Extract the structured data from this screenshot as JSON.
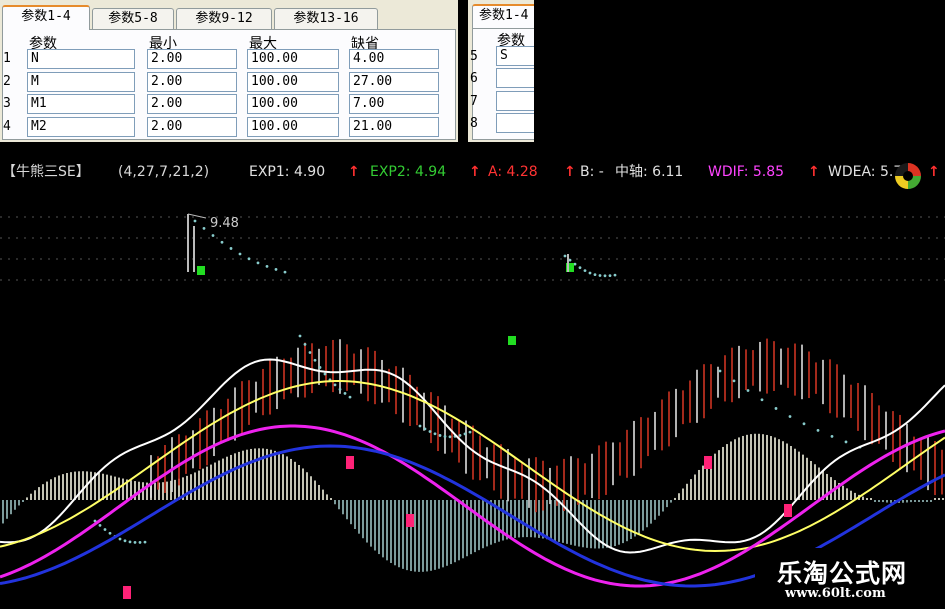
{
  "dialog": {
    "tabs": [
      "参数1-4",
      "参数5-8",
      "参数9-12",
      "参数13-16"
    ],
    "active_tab": 0,
    "headers": {
      "param": "参数",
      "min": "最小",
      "max": "最大",
      "default": "缺省"
    },
    "rows": [
      {
        "num": "1",
        "name": "N",
        "min": "2.00",
        "max": "100.00",
        "default": "4.00"
      },
      {
        "num": "2",
        "name": "M",
        "min": "2.00",
        "max": "100.00",
        "default": "27.00"
      },
      {
        "num": "3",
        "name": "M1",
        "min": "2.00",
        "max": "100.00",
        "default": "7.00"
      },
      {
        "num": "4",
        "name": "M2",
        "min": "2.00",
        "max": "100.00",
        "default": "21.00"
      }
    ]
  },
  "dialog2": {
    "tab": "参数1-4",
    "header": "参数",
    "rows": [
      {
        "num": "5",
        "name": "S"
      },
      {
        "num": "6",
        "name": ""
      },
      {
        "num": "7",
        "name": ""
      },
      {
        "num": "8",
        "name": ""
      }
    ]
  },
  "indicator": {
    "name": "【牛熊三SE】",
    "params": "(4,27,7,21,2)",
    "items": [
      {
        "label": "EXP1: 4.90",
        "color": "#e0e0e0"
      },
      {
        "label": "EXP2: 4.94",
        "color": "#33cc33"
      },
      {
        "label": "A: 4.28",
        "color": "#ff3333"
      },
      {
        "label": "B: -",
        "color": "#e0e0e0"
      },
      {
        "label": "中轴: 6.11",
        "color": "#e0e0e0"
      },
      {
        "label": "WDIF: 5.85",
        "color": "#ff44ff"
      },
      {
        "label": "WDEA: 5.70",
        "color": "#e0e0e0"
      }
    ],
    "arrow": "↑"
  },
  "chart_annotation": "9.48",
  "watermark": {
    "title": "乐淘公式网",
    "url": "www.60lt.com"
  },
  "colors": {
    "white_line": "#ffffff",
    "yellow_line": "#ffff66",
    "magenta_line": "#ee22ee",
    "blue_line": "#2233dd",
    "hist_pos": "#d8d8c8",
    "hist_neg": "#88aaaa",
    "marker_green": "#22dd22",
    "marker_pink": "#ff2277"
  }
}
